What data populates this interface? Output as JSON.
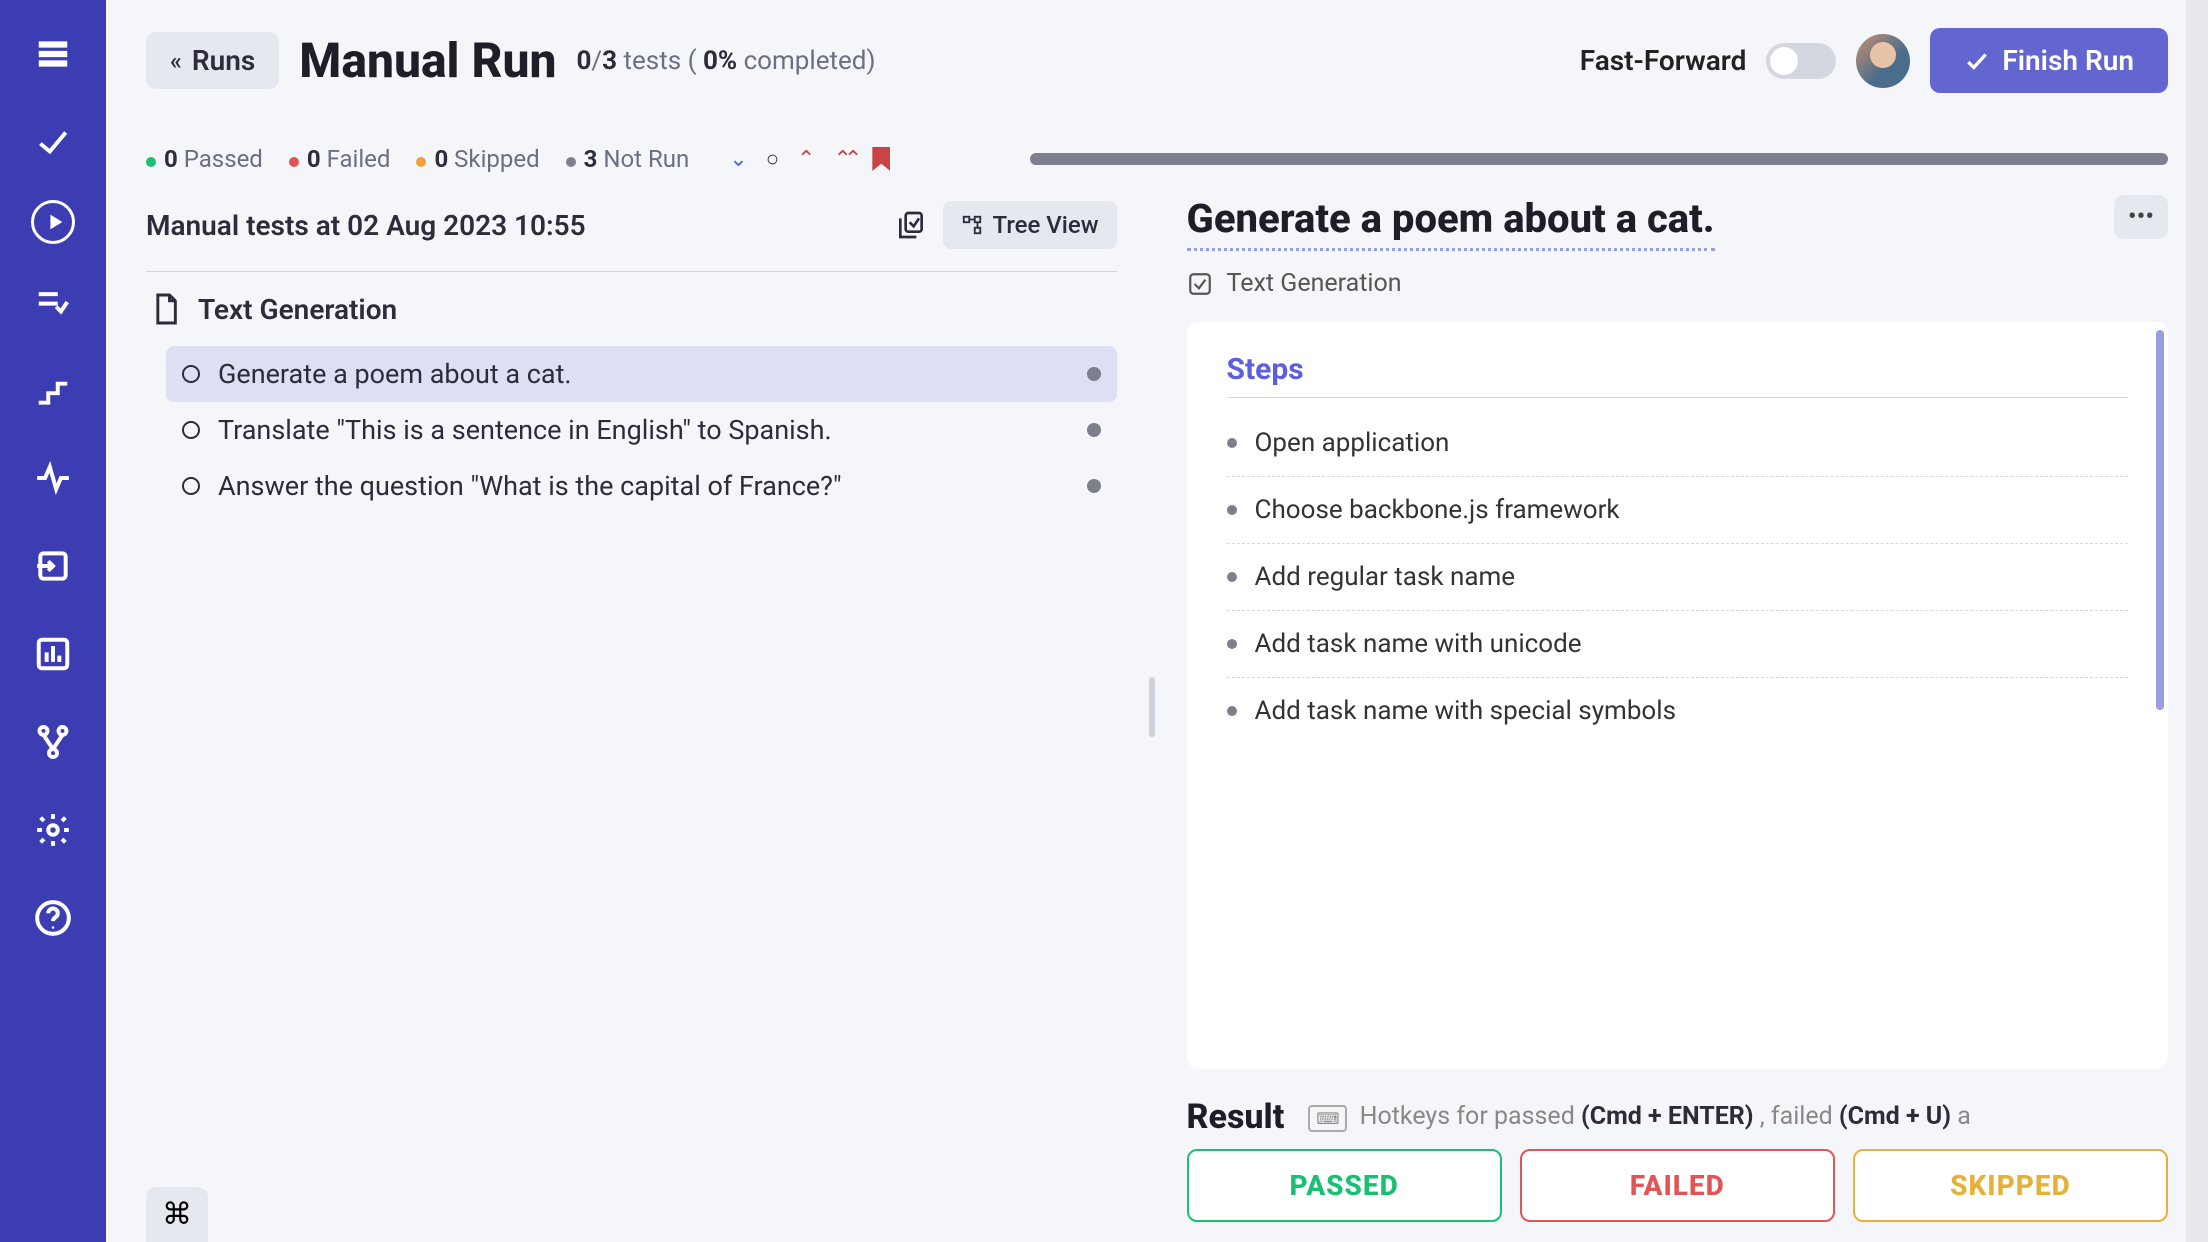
{
  "header": {
    "back_label": "Runs",
    "page_title": "Manual Run",
    "count_done": "0",
    "count_total": "3",
    "count_word": "tests",
    "percent": "0%",
    "completed_word": "completed",
    "ff_label": "Fast-Forward",
    "finish_label": "Finish Run"
  },
  "stats": {
    "passed_n": "0",
    "passed_w": "Passed",
    "failed_n": "0",
    "failed_w": "Failed",
    "skipped_n": "0",
    "skipped_w": "Skipped",
    "notrun_n": "3",
    "notrun_w": "Not Run"
  },
  "left": {
    "title": "Manual tests at 02 Aug 2023 10:55",
    "treeview_label": "Tree View",
    "category": "Text Generation",
    "tests": [
      "Generate a poem about a cat.",
      "Translate \"This is a sentence in English\" to Spanish.",
      "Answer the question \"What is the capital of France?\""
    ]
  },
  "detail": {
    "title": "Generate a poem about a cat.",
    "category": "Text Generation",
    "steps_title": "Steps",
    "steps": [
      "Open application",
      "Choose backbone.js framework",
      "Add regular task name",
      "Add task name with unicode",
      "Add task name with special symbols"
    ],
    "result_title": "Result",
    "hotkey_prefix": "Hotkeys for passed",
    "hotkey_pass": "(Cmd + ENTER)",
    "hotkey_mid": ", failed",
    "hotkey_fail": "(Cmd + U)",
    "hotkey_suffix": "a",
    "btn_pass": "PASSED",
    "btn_fail": "FAILED",
    "btn_skip": "SKIPPED"
  },
  "cmd_glyph": "⌘"
}
